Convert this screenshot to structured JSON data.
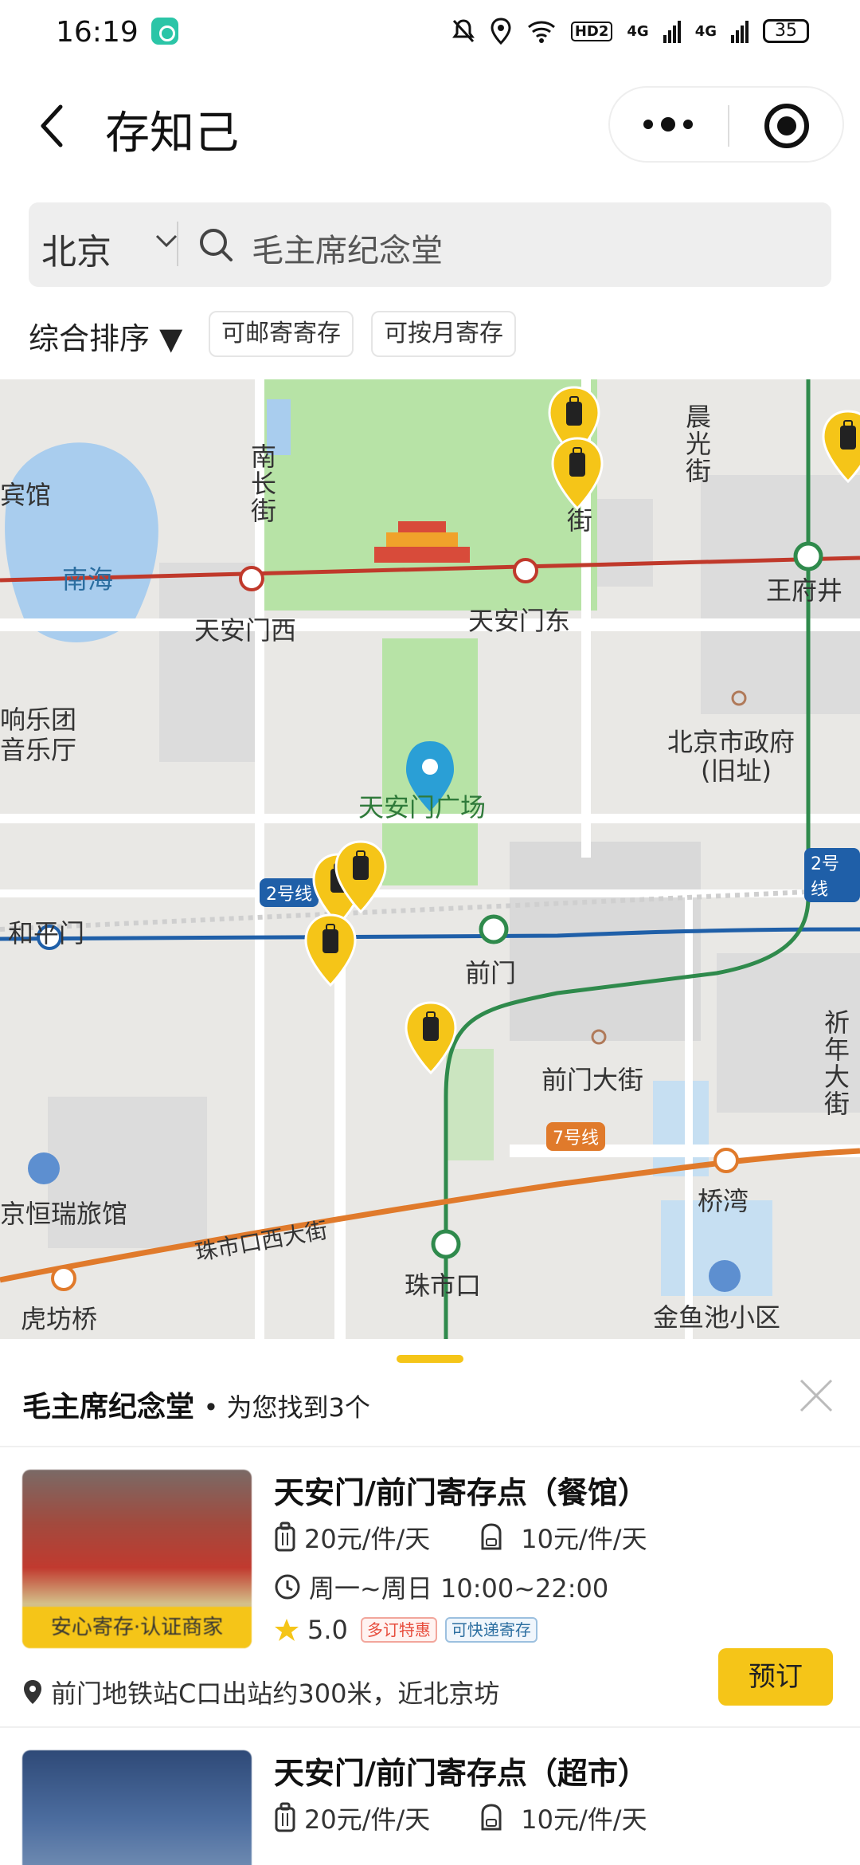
{
  "status_bar": {
    "time": "16:19",
    "battery": "35",
    "hd": "HD2",
    "net1": "4G",
    "net2": "4G"
  },
  "header": {
    "title": "存知己"
  },
  "search": {
    "city": "北京",
    "query": "毛主席纪念堂"
  },
  "filters": {
    "sort_label": "综合排序 ▼",
    "chip1": "可邮寄寄存",
    "chip2": "可按月寄存"
  },
  "map": {
    "labels": {
      "nanhai": "南海",
      "binguan": "宾馆",
      "nanchangjie": "南长街",
      "chenguangjie": "晨光街",
      "jie": "街",
      "wangfujing": "王府井",
      "tiananmen_west": "天安门西",
      "tiananmen_east": "天安门东",
      "concert1": "响乐团",
      "concert2": "音乐厅",
      "beijing_gov1": "北京市政府",
      "beijing_gov2": "(旧址)",
      "square": "天安门广场",
      "heping_men": "和平门",
      "qianmen": "前门",
      "qianmen_street": "前门大街",
      "xinnian_street": "祈年大街",
      "hengrui_hotel": "京恒瑞旅馆",
      "zhushikou_west": "珠市口西大街",
      "zhushikou": "珠市口",
      "qiaowan": "桥湾",
      "hufangqiao": "虎坊桥",
      "jinyuchi": "金鱼池小区"
    },
    "lines": {
      "line2_a": "2号线",
      "line2_b": "2号线",
      "line7": "7号线"
    },
    "colors": {
      "line1": "#c0392b",
      "line2": "#1f5fa8",
      "line7": "#e07a2b",
      "greenline": "#2f8a4c",
      "park": "#b7e3a6",
      "water": "#a9cdee",
      "pin": "#f5c518"
    }
  },
  "results": {
    "place": "毛主席纪念堂",
    "summary": "• 为您找到3个",
    "items": [
      {
        "title": "天安门/前门寄存点（餐馆）",
        "badge": "安心寄存·认证商家",
        "price_large": "20元/件/天",
        "price_small": "10元/件/天",
        "hours": "周一~周日 10:00~22:00",
        "rating": "5.0",
        "tag1": "多订特惠",
        "tag2": "可快递寄存",
        "address": "前门地铁站C口出站约300米，近北京坊",
        "book_label": "预订"
      },
      {
        "title": "天安门/前门寄存点（超市）",
        "price_large": "20元/件/天",
        "price_small": "10元/件/天"
      }
    ]
  }
}
